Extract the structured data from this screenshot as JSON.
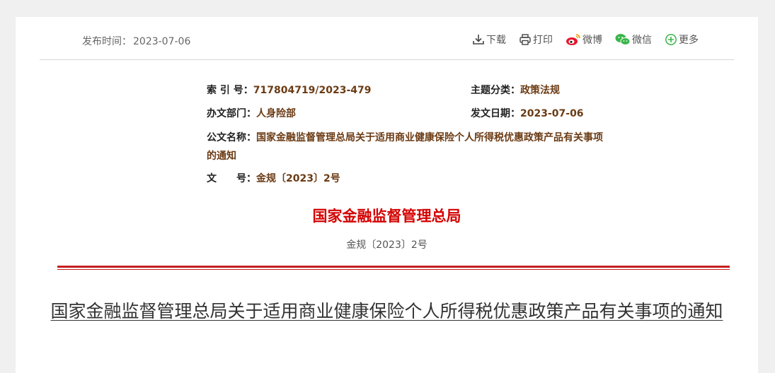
{
  "header": {
    "pubtime_label": "发布时间：",
    "pubtime_value": "2023-07-06",
    "actions": {
      "download": "下载",
      "print": "打印",
      "weibo": "微博",
      "wechat": "微信",
      "more": "更多"
    }
  },
  "meta": {
    "index_label": "索 引 号：",
    "index_value": "717804719/2023-479",
    "topic_label": "主题分类：",
    "topic_value": "政策法规",
    "dept_label": "办文部门：",
    "dept_value": "人身险部",
    "date_label": "发文日期：",
    "date_value": "2023-07-06",
    "name_label": "公文名称：",
    "name_value": "国家金融监督管理总局关于适用商业健康保险个人所得税优惠政策产品有关事项的通知",
    "docnum_label": "文　　号：",
    "docnum_value": "金规〔2023〕2号"
  },
  "body": {
    "issuer": "国家金融监督管理总局",
    "doc_number": "金规〔2023〕2号",
    "title": "国家金融监督管理总局关于适用商业健康保险个人所得税优惠政策产品有关事项的通知"
  },
  "colors": {
    "issuer_red": "#d40000",
    "meta_value_brown": "#6b3b14",
    "divider_red": "#c51f1f"
  }
}
